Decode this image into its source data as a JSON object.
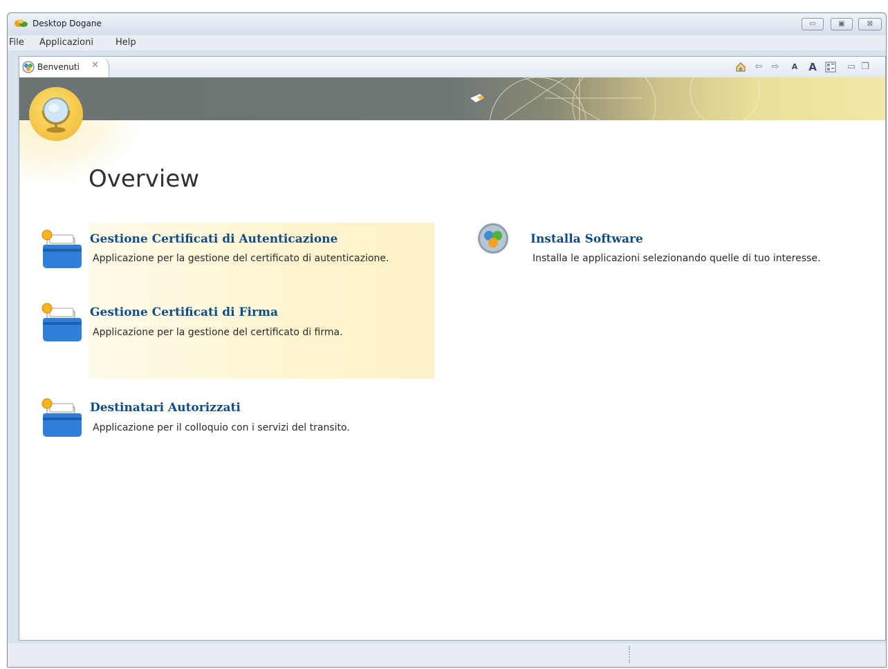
{
  "window": {
    "title": "Desktop Dogane",
    "controls": [
      "minimize-icon",
      "maximize-icon",
      "close-icon"
    ]
  },
  "menu": {
    "items": [
      "File",
      "Applicazioni",
      "Help"
    ]
  },
  "tab": {
    "label": "Benvenuti",
    "close_glyph": "✕"
  },
  "toolbar": {
    "icons": [
      "home-icon",
      "back-icon",
      "forward-icon",
      "decrease-font-icon",
      "increase-font-icon",
      "layout-icon",
      "minimize-view-icon",
      "restore-view-icon"
    ]
  },
  "page": {
    "title": "Overview"
  },
  "items": [
    {
      "title": "Gestione Certificati di Autenticazione",
      "description": "Applicazione per la gestione del certificato di autenticazione."
    },
    {
      "title": "Gestione Certificati di Firma",
      "description": "Applicazione per la gestione del certificato di firma."
    },
    {
      "title": "Destinatari Autorizzati",
      "description": "Applicazione per il colloquio con i servizi del transito."
    },
    {
      "title": "Installa Software",
      "description": "Installa le applicazioni selezionando quelle di tuo interesse."
    }
  ],
  "colors": {
    "link": "#0e4c85",
    "banner_dark": "#6b7473",
    "banner_gold": "#f2e7a6",
    "highlight": "#fdf2c8"
  }
}
